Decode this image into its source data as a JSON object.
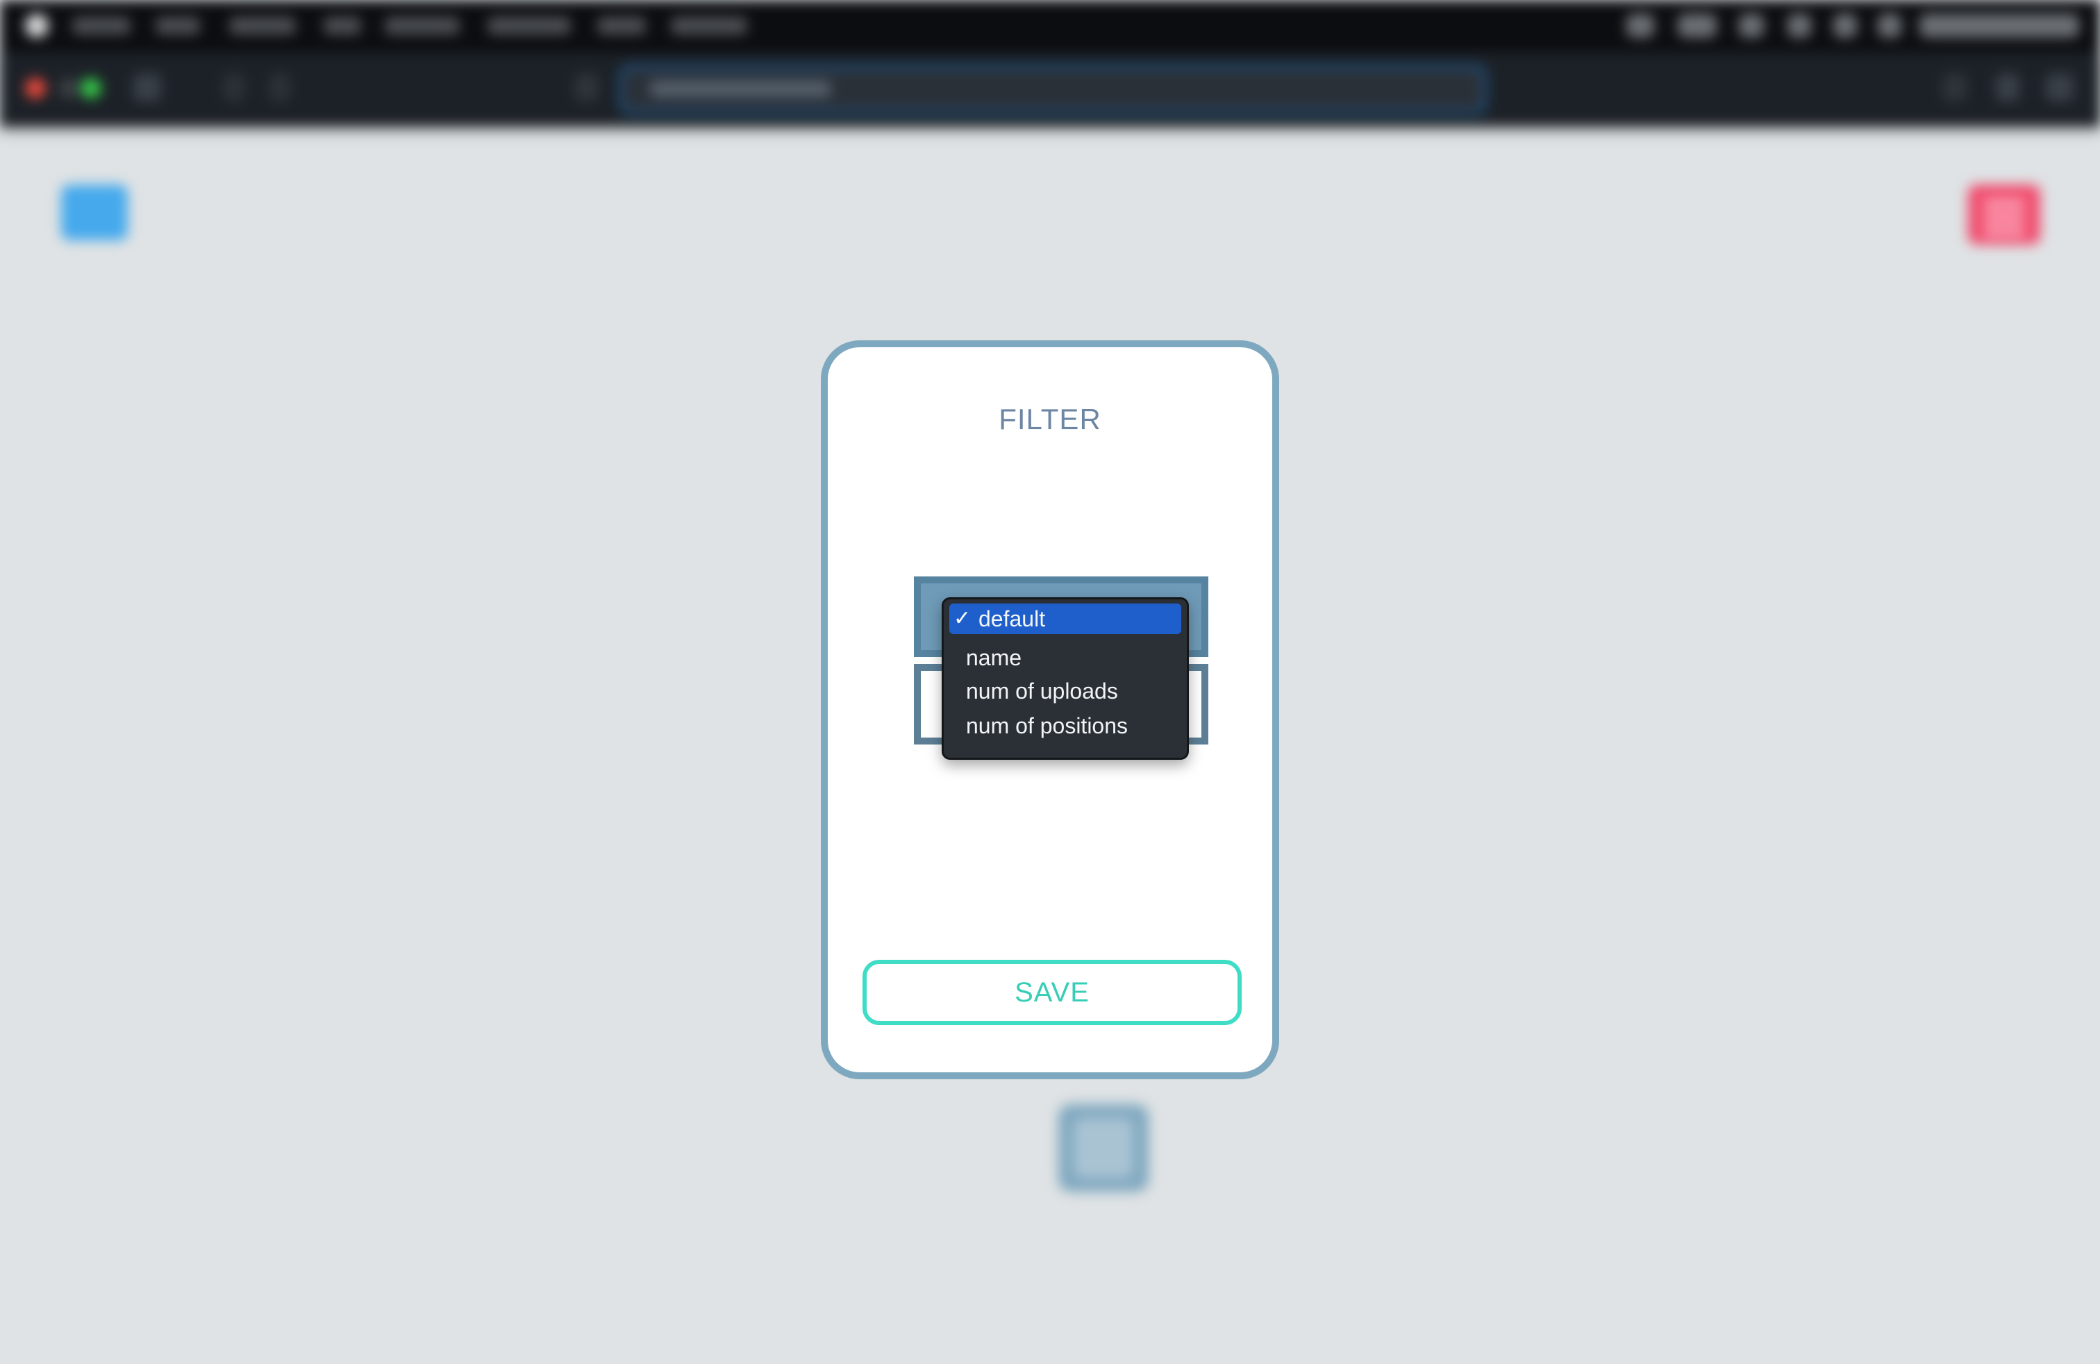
{
  "modal": {
    "title": "FILTER",
    "save_label": "SAVE"
  },
  "sort_dropdown": {
    "selected": "default",
    "check_mark": "✓",
    "options": [
      {
        "label": "default",
        "selected": true
      },
      {
        "label": "name",
        "selected": false
      },
      {
        "label": "num of uploads",
        "selected": false
      },
      {
        "label": "num of positions",
        "selected": false
      }
    ]
  },
  "colors": {
    "modal_border": "#7ea8bf",
    "title": "#6d86a3",
    "save_accent": "#3fdcc6",
    "selected_option": "#1f5fcc",
    "dropdown_bg": "#2b3036",
    "left_chip": "#45a9ec",
    "right_chip": "#f04a6c",
    "address_focus": "#1d6fb8"
  },
  "icons": {
    "check": "check-icon",
    "apple": "apple-icon"
  }
}
